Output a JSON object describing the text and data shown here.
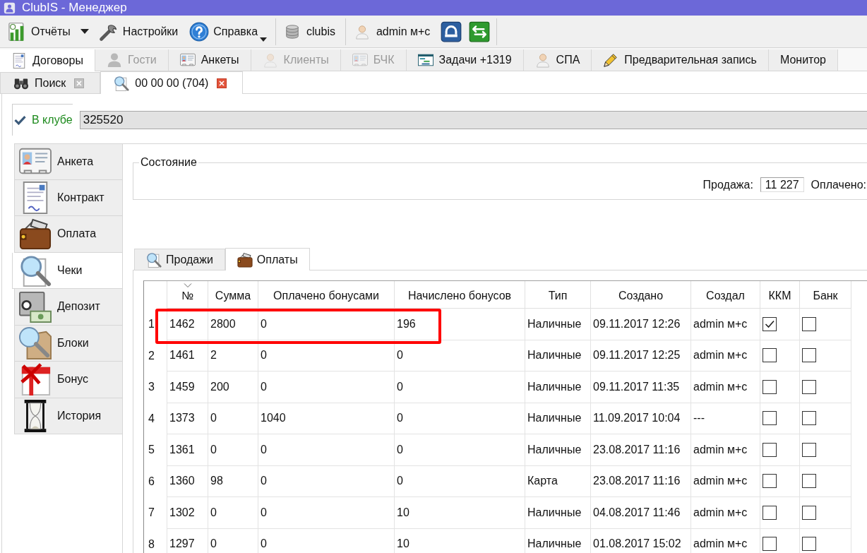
{
  "window": {
    "title": "ClubIS - Менеджер"
  },
  "toolbar": {
    "groups": [
      {
        "items": [
          {
            "kind": "split",
            "label": "Отчёты"
          },
          {
            "kind": "button",
            "label": "Настройки"
          },
          {
            "kind": "menu",
            "label": "Справка"
          }
        ]
      },
      {
        "items": [
          {
            "kind": "label",
            "label": "clubis"
          }
        ]
      },
      {
        "items": [
          {
            "kind": "label",
            "label": "admin м+с"
          },
          {
            "kind": "icon"
          },
          {
            "kind": "icon"
          }
        ]
      }
    ]
  },
  "tabs": [
    {
      "label": "Договоры",
      "selected": true,
      "disabled": false
    },
    {
      "label": "Гости",
      "selected": false,
      "disabled": true
    },
    {
      "label": "Анкеты",
      "selected": false,
      "disabled": false
    },
    {
      "label": "Клиенты",
      "selected": false,
      "disabled": true
    },
    {
      "label": "БЧК",
      "selected": false,
      "disabled": true
    },
    {
      "label": "Задачи +1319",
      "selected": false,
      "disabled": false
    },
    {
      "label": "СПА",
      "selected": false,
      "disabled": false
    },
    {
      "label": "Предварительная запись",
      "selected": false,
      "disabled": false
    },
    {
      "label": "Монитор",
      "selected": false,
      "disabled": false
    }
  ],
  "document_tabs": [
    {
      "label": "Поиск",
      "selected": false
    },
    {
      "label": "00 00 00 (704)",
      "selected": true
    }
  ],
  "club_status": {
    "checked": true,
    "label": "В клубе",
    "value": "325520"
  },
  "sidebar": {
    "items": [
      {
        "label": "Анкета",
        "selected": false
      },
      {
        "label": "Контракт",
        "selected": false
      },
      {
        "label": "Оплата",
        "selected": false
      },
      {
        "label": "Чеки",
        "selected": true
      },
      {
        "label": "Депозит",
        "selected": false
      },
      {
        "label": "Блоки",
        "selected": false
      },
      {
        "label": "Бонус",
        "selected": false
      },
      {
        "label": "История",
        "selected": false
      }
    ]
  },
  "state_group": {
    "title": "Состояние",
    "fields": [
      {
        "label": "Продажа:",
        "value": "11 227"
      },
      {
        "label": "Оплачено:"
      }
    ]
  },
  "subtabs": [
    {
      "label": "Продажи",
      "selected": false
    },
    {
      "label": "Оплаты",
      "selected": true
    }
  ],
  "table": {
    "columns": [
      {
        "label": "№",
        "kind": "text",
        "sorted": true
      },
      {
        "label": "Сумма",
        "kind": "text",
        "sorted": false
      },
      {
        "label": "Оплачено бонусами",
        "kind": "text",
        "sorted": false
      },
      {
        "label": "Начислено бонусов",
        "kind": "text",
        "sorted": false
      },
      {
        "label": "Тип",
        "kind": "text",
        "sorted": false
      },
      {
        "label": "Создано",
        "kind": "text",
        "sorted": false
      },
      {
        "label": "Создал",
        "kind": "text",
        "sorted": false
      },
      {
        "label": "ККМ",
        "kind": "checkbox",
        "sorted": false
      },
      {
        "label": "Банк",
        "kind": "checkbox",
        "sorted": false
      }
    ],
    "rows": [
      {
        "index": "1",
        "highlighted": true,
        "cells": [
          "1462",
          "2800",
          "0",
          "196",
          "Наличные",
          "09.11.2017 12:26",
          "admin м+с",
          true,
          false
        ]
      },
      {
        "index": "2",
        "highlighted": false,
        "cells": [
          "1461",
          "2",
          "0",
          "0",
          "Наличные",
          "09.11.2017 12:25",
          "admin м+с",
          false,
          false
        ]
      },
      {
        "index": "3",
        "highlighted": false,
        "cells": [
          "1459",
          "200",
          "0",
          "0",
          "Наличные",
          "09.11.2017 11:35",
          "admin м+с",
          false,
          false
        ]
      },
      {
        "index": "4",
        "highlighted": false,
        "cells": [
          "1373",
          "0",
          "1040",
          "0",
          "Наличные",
          "11.09.2017 10:04",
          "---",
          false,
          false
        ]
      },
      {
        "index": "5",
        "highlighted": false,
        "cells": [
          "1361",
          "0",
          "0",
          "0",
          "Наличные",
          "23.08.2017 11:16",
          "admin м+с",
          false,
          false
        ]
      },
      {
        "index": "6",
        "highlighted": false,
        "cells": [
          "1360",
          "98",
          "0",
          "0",
          "Карта",
          "23.08.2017 11:16",
          "admin м+с",
          false,
          false
        ]
      },
      {
        "index": "7",
        "highlighted": false,
        "cells": [
          "1302",
          "0",
          "0",
          "10",
          "Наличные",
          "04.08.2017 11:46",
          "admin м+с",
          false,
          false
        ]
      },
      {
        "index": "8",
        "highlighted": false,
        "cells": [
          "1297",
          "0",
          "0",
          "10",
          "Наличные",
          "01.08.2017 15:02",
          "admin м+с",
          false,
          false
        ]
      }
    ]
  }
}
